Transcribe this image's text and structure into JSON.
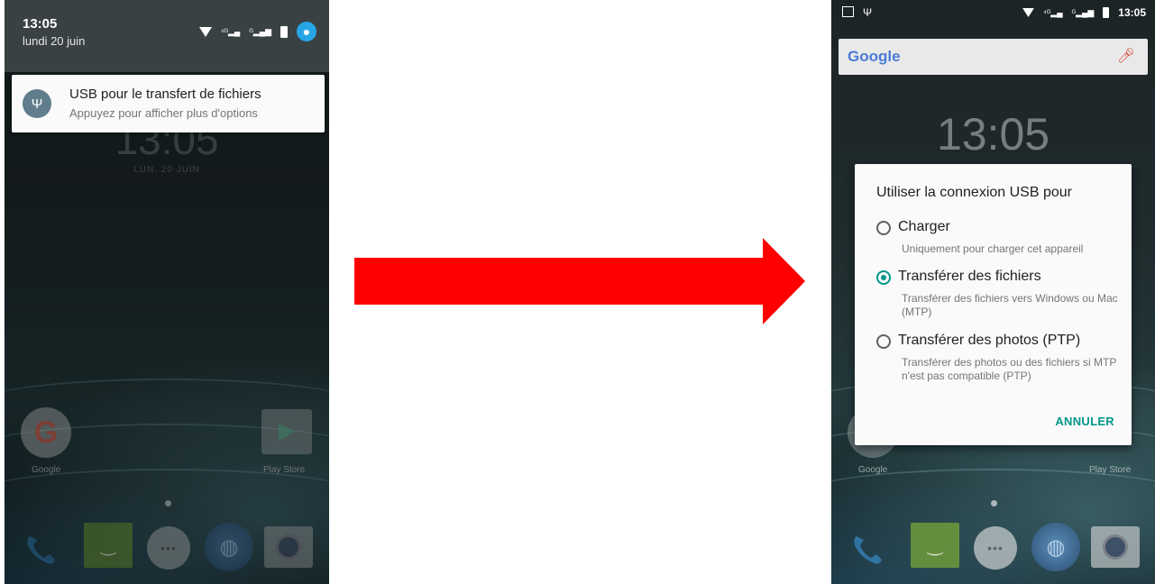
{
  "left_phone": {
    "status_time": "13:05",
    "status_date": "lundi 20 juin",
    "notification": {
      "title": "USB pour le transfert de fichiers",
      "subtitle": "Appuyez pour afficher plus d'options"
    },
    "behind_clock": "13:05",
    "behind_date": "LUN. 20 JUIN",
    "apps": {
      "google_label": "Google",
      "play_store_label": "Play Store"
    }
  },
  "right_phone": {
    "status_time": "13:05",
    "search_logo": "Google",
    "clock": "13:05",
    "dialog": {
      "title": "Utiliser la connexion USB pour",
      "options": [
        {
          "label": "Charger",
          "description": "Uniquement pour charger cet appareil",
          "selected": false
        },
        {
          "label": "Transférer des fichiers",
          "description": "Transférer des fichiers vers Windows ou Mac (MTP)",
          "selected": true
        },
        {
          "label": "Transférer des photos (PTP)",
          "description": "Transférer des photos ou des fichiers si MTP n'est pas compatible (PTP)",
          "selected": false
        }
      ],
      "cancel_label": "ANNULER"
    },
    "apps": {
      "google_label": "Google",
      "play_store_label": "Play Store"
    }
  },
  "colors": {
    "arrow": "#ff0000",
    "accent": "#009688",
    "notif_icon_bg": "#607d8b",
    "avatar": "#27a6e6"
  },
  "icons": [
    "wifi-icon",
    "signal-icon",
    "battery-icon",
    "avatar-icon",
    "usb-icon",
    "image-icon",
    "mic-icon",
    "phone-icon",
    "messages-icon",
    "app-drawer-icon",
    "browser-icon",
    "camera-icon",
    "google-icon",
    "play-store-icon"
  ]
}
